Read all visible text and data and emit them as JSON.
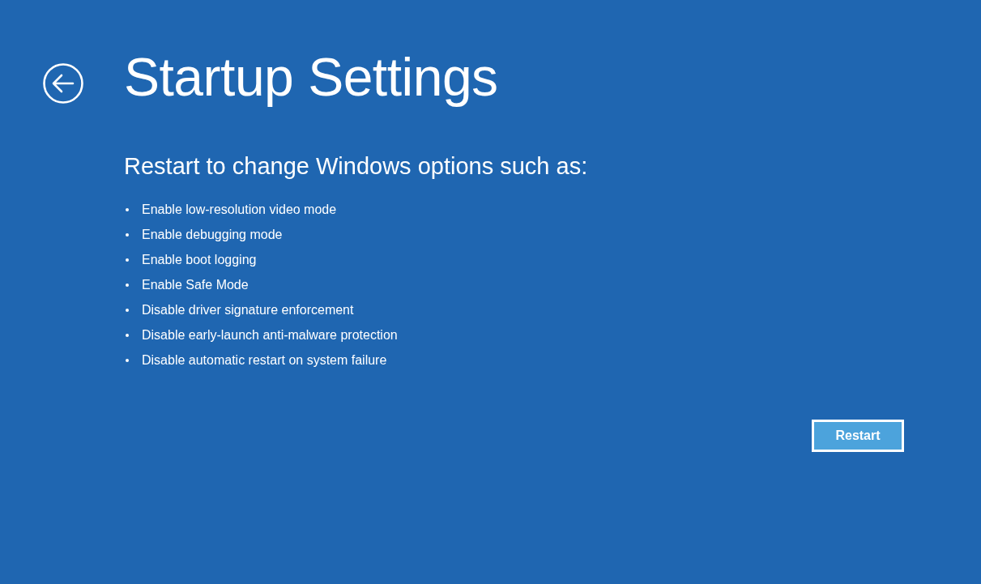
{
  "header": {
    "title": "Startup Settings"
  },
  "content": {
    "subtitle": "Restart to change Windows options such as:",
    "options": [
      "Enable low-resolution video mode",
      "Enable debugging mode",
      "Enable boot logging",
      "Enable Safe Mode",
      "Disable driver signature enforcement",
      "Disable early-launch anti-malware protection",
      "Disable automatic restart on system failure"
    ]
  },
  "buttons": [
    {
      "label": "Restart"
    }
  ]
}
